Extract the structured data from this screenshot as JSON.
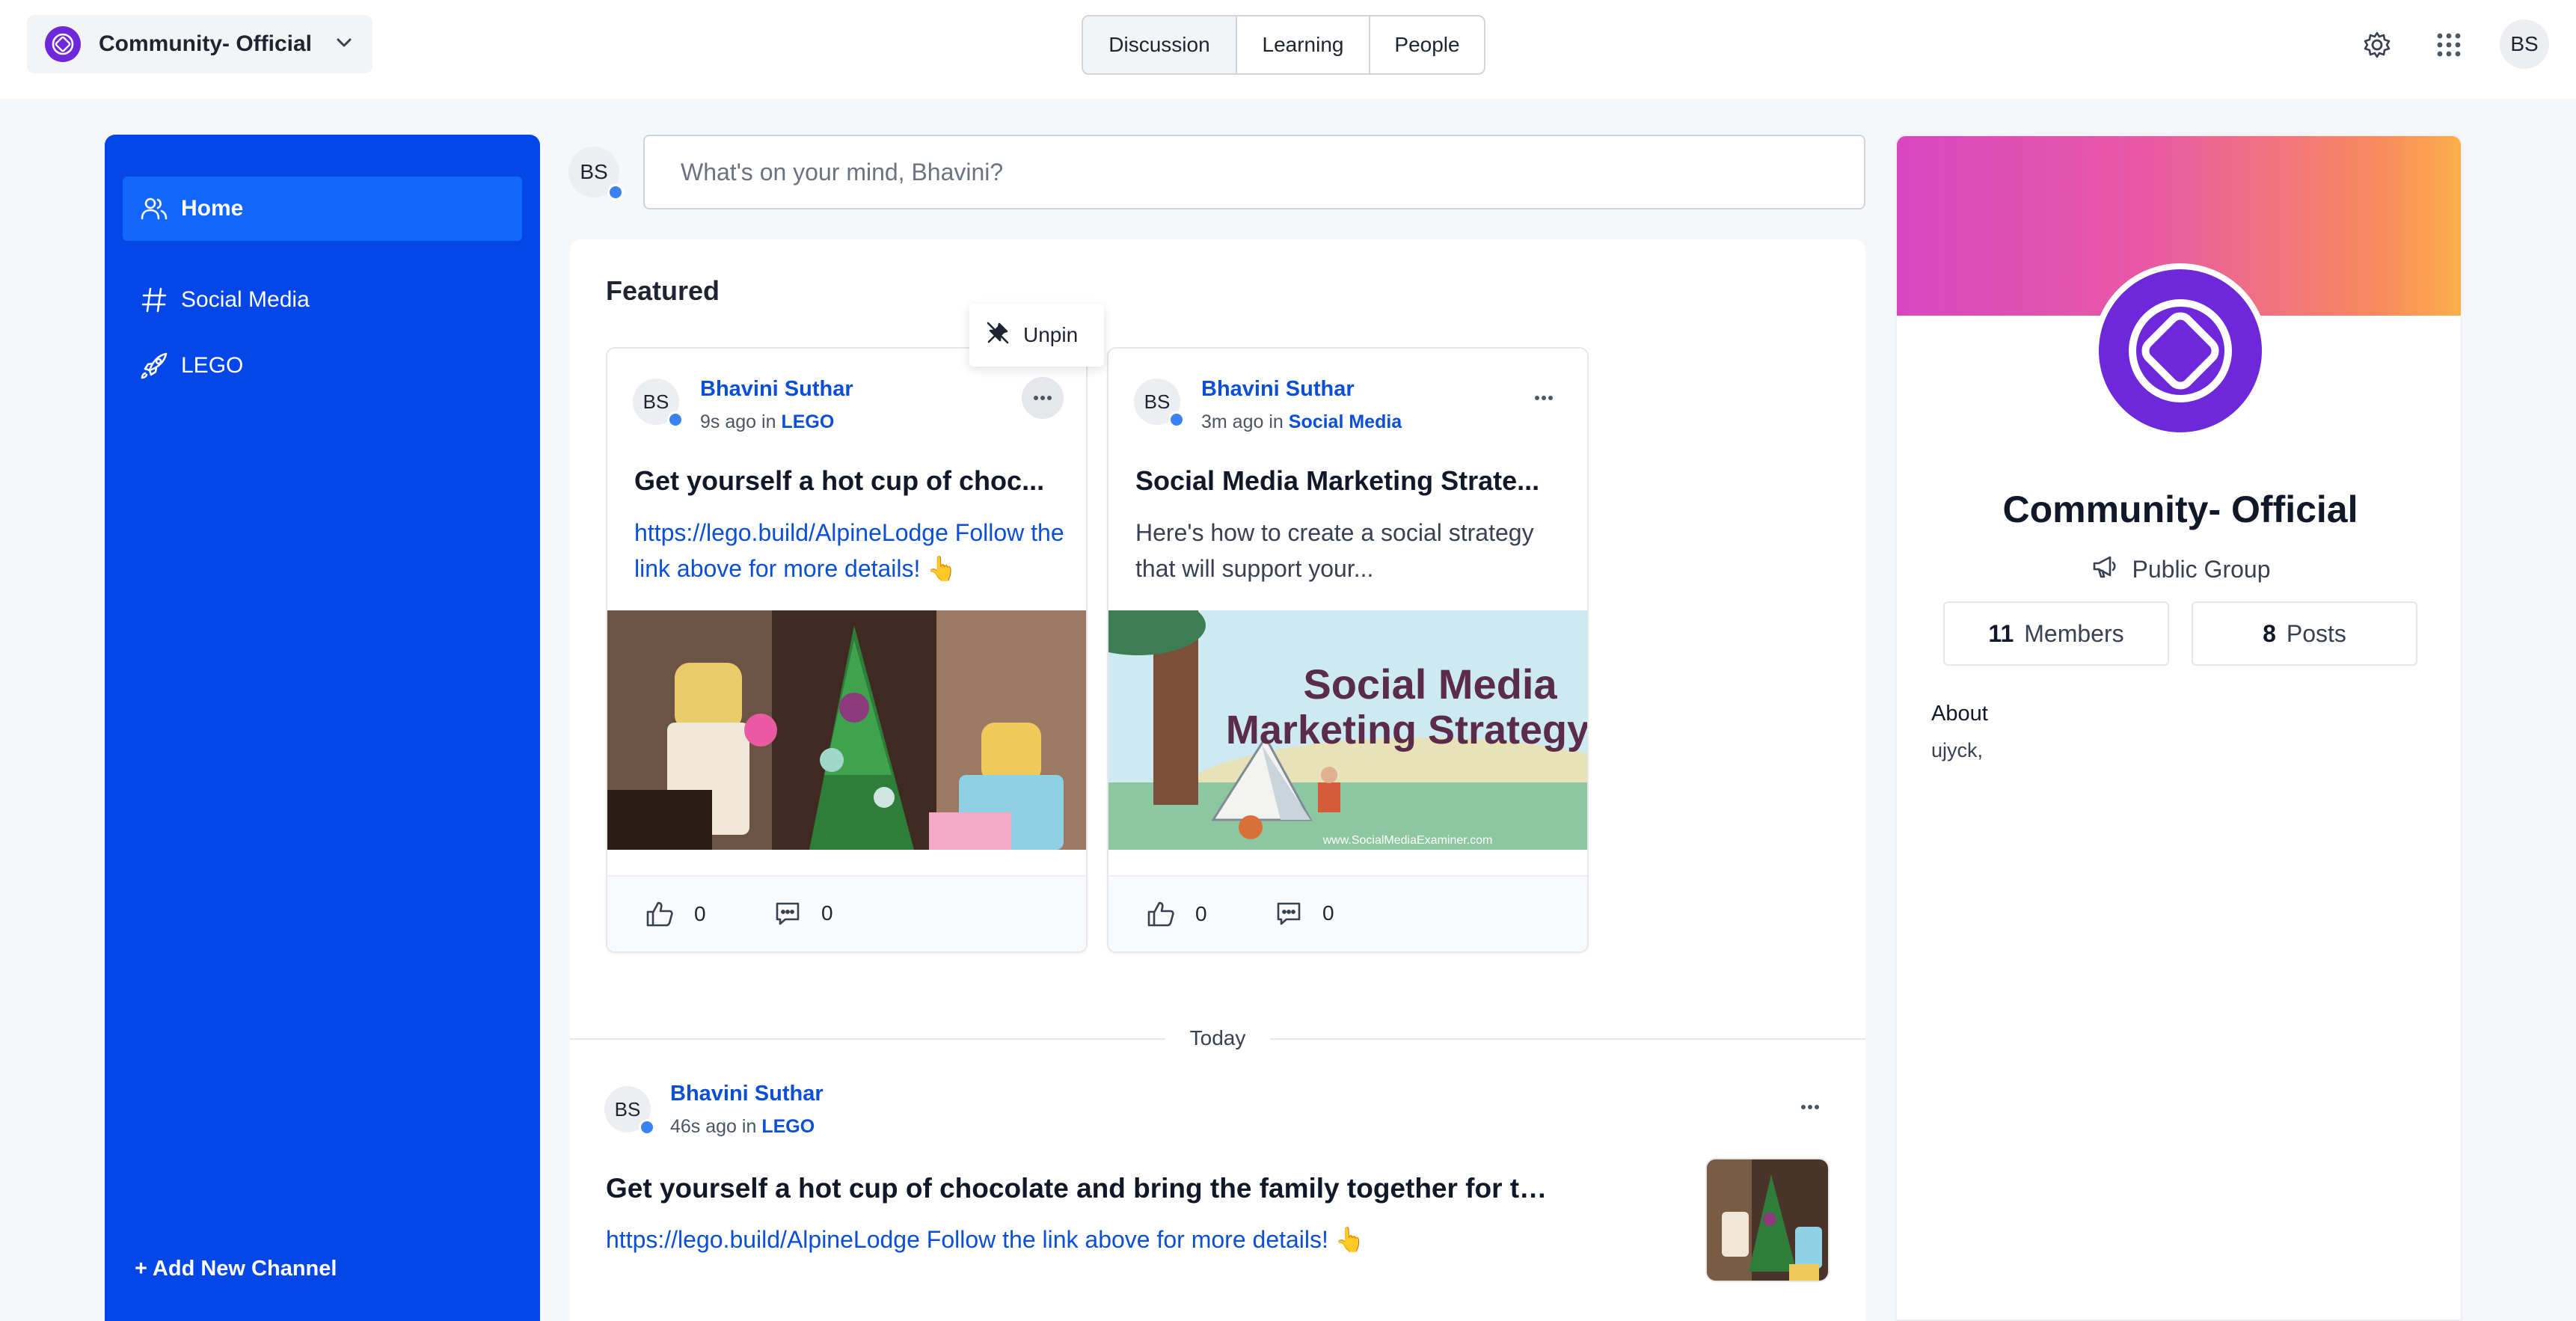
{
  "topbar": {
    "community_name": "Community- Official",
    "tabs": [
      {
        "label": "Discussion",
        "active": true
      },
      {
        "label": "Learning",
        "active": false
      },
      {
        "label": "People",
        "active": false
      }
    ],
    "user_initials": "BS",
    "icons": [
      "community-logo-icon",
      "chevron-down-icon",
      "gear-icon",
      "apps-grid-icon"
    ]
  },
  "sidebar": {
    "items": [
      {
        "label": "Home",
        "icon": "people-icon",
        "active": true
      },
      {
        "label": "Social Media",
        "icon": "hash-icon",
        "active": false
      },
      {
        "label": "LEGO",
        "icon": "rocket-icon",
        "active": false
      }
    ],
    "add_channel": "+ Add New Channel",
    "bg_color": "#0447e6"
  },
  "composer": {
    "avatar": "BS",
    "placeholder": "What's on your mind, Bhavini?"
  },
  "featured": {
    "title": "Featured",
    "unpin_label": "Unpin",
    "cards": [
      {
        "avatar": "BS",
        "author": "Bhavini Suthar",
        "time": "9s ago",
        "in": "in",
        "channel": "LEGO",
        "title": "Get yourself a hot cup of choc...",
        "body": "https://lego.build/AlpineLodge Follow the link above for more details! 👆",
        "likes": "0",
        "comments": "0"
      },
      {
        "avatar": "BS",
        "author": "Bhavini Suthar",
        "time": "3m ago",
        "in": "in",
        "channel": "Social Media",
        "title": "Social Media Marketing Strate...",
        "body": "Here's how to create a social strategy that will support your...",
        "image_text_1": "Social Media",
        "image_text_2": "Marketing Strategy",
        "image_caption": "www.SocialMediaExaminer.com",
        "likes": "0",
        "comments": "0"
      }
    ]
  },
  "timeline": {
    "divider": "Today",
    "post": {
      "avatar": "BS",
      "author": "Bhavini Suthar",
      "time": "46s ago",
      "in": "in",
      "channel": "LEGO",
      "title": "Get yourself a hot cup of chocolate and bring the family together for the...",
      "body": "https://lego.build/AlpineLodge Follow the link above for more details! 👆"
    }
  },
  "group": {
    "name": "Community- Official",
    "type": "Public Group",
    "members_count": "11",
    "members_label": "Members",
    "posts_count": "8",
    "posts_label": "Posts",
    "about_label": "About",
    "about_text": "ujyck,"
  }
}
